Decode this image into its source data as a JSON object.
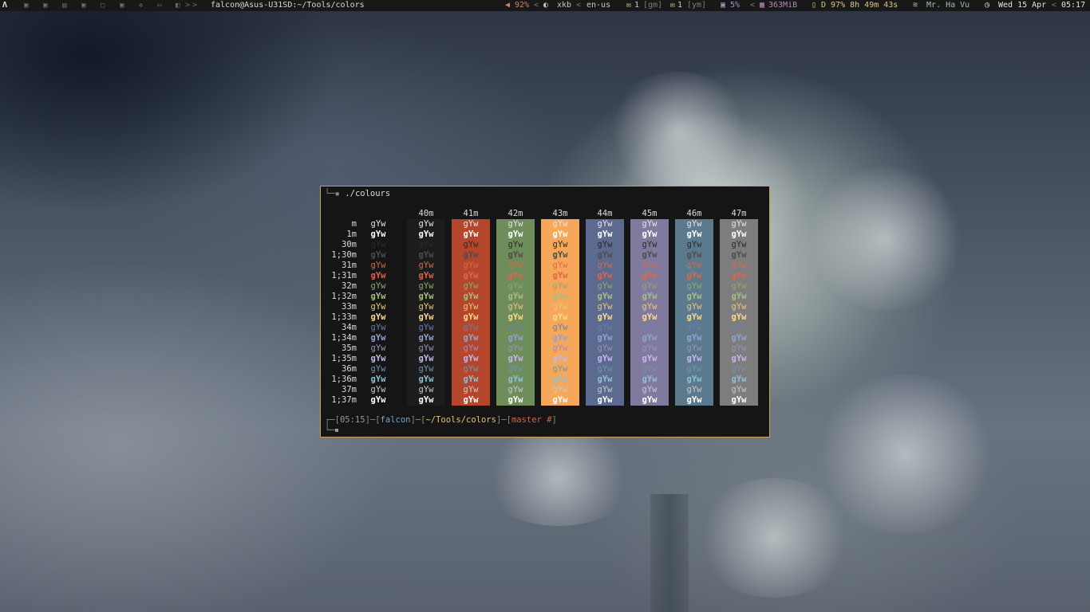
{
  "topbar": {
    "arch_icon": "arch-logo-icon",
    "workspaces": [
      "ws-1-icon",
      "ws-2-icon",
      "ws-3-icon",
      "ws-4-icon",
      "ws-5-icon",
      "ws-6-icon",
      "ws-7-icon",
      "ws-8-icon",
      "ws-9-icon"
    ],
    "window_title": "falcon@Asus-U31SD:~/Tools/colors",
    "volume": "92%",
    "kb_label": "xkb",
    "kb_layout": "en-us",
    "mail1_count": "1",
    "mail1_name": "[gm]",
    "mail2_count": "1",
    "mail2_name": "[ym]",
    "cpu": "5%",
    "mem": "363MiB",
    "battery": "D 97% 8h 49m 43s",
    "wifi": "Mr. Ha Vu",
    "date": "Wed 15 Apr",
    "time": "05:17"
  },
  "terminal": {
    "command": "./colours",
    "bg_headers": [
      "40m",
      "41m",
      "42m",
      "43m",
      "44m",
      "45m",
      "46m",
      "47m"
    ],
    "bg_colors": [
      "#1c1c1c",
      "#b5462b",
      "#6f8d5b",
      "#f6a759",
      "#5c6a8f",
      "#807a9f",
      "#5c7a8e",
      "#7d7d7d"
    ],
    "row_labels": [
      "m",
      "1m",
      "30m",
      "1;30m",
      "31m",
      "1;31m",
      "32m",
      "1;32m",
      "33m",
      "1;33m",
      "34m",
      "1;34m",
      "35m",
      "1;35m",
      "36m",
      "1;36m",
      "37m",
      "1;37m"
    ],
    "fg_colors": [
      "#e4e4e4",
      "#ffffff",
      "#2a2a2a",
      "#4c4c4c",
      "#d26b4a",
      "#e0654a",
      "#8fa86f",
      "#a4c080",
      "#f0c67a",
      "#ffd98a",
      "#6a7fa6",
      "#8ea4d2",
      "#9b8fc0",
      "#c4b6ee",
      "#6e96aa",
      "#8cc1d6",
      "#c9c9c9",
      "#ffffff"
    ],
    "sample": "gYw",
    "prompt": {
      "time": "05:15",
      "user": "falcon",
      "dir": "~/Tools/colors",
      "git": "master #"
    }
  }
}
